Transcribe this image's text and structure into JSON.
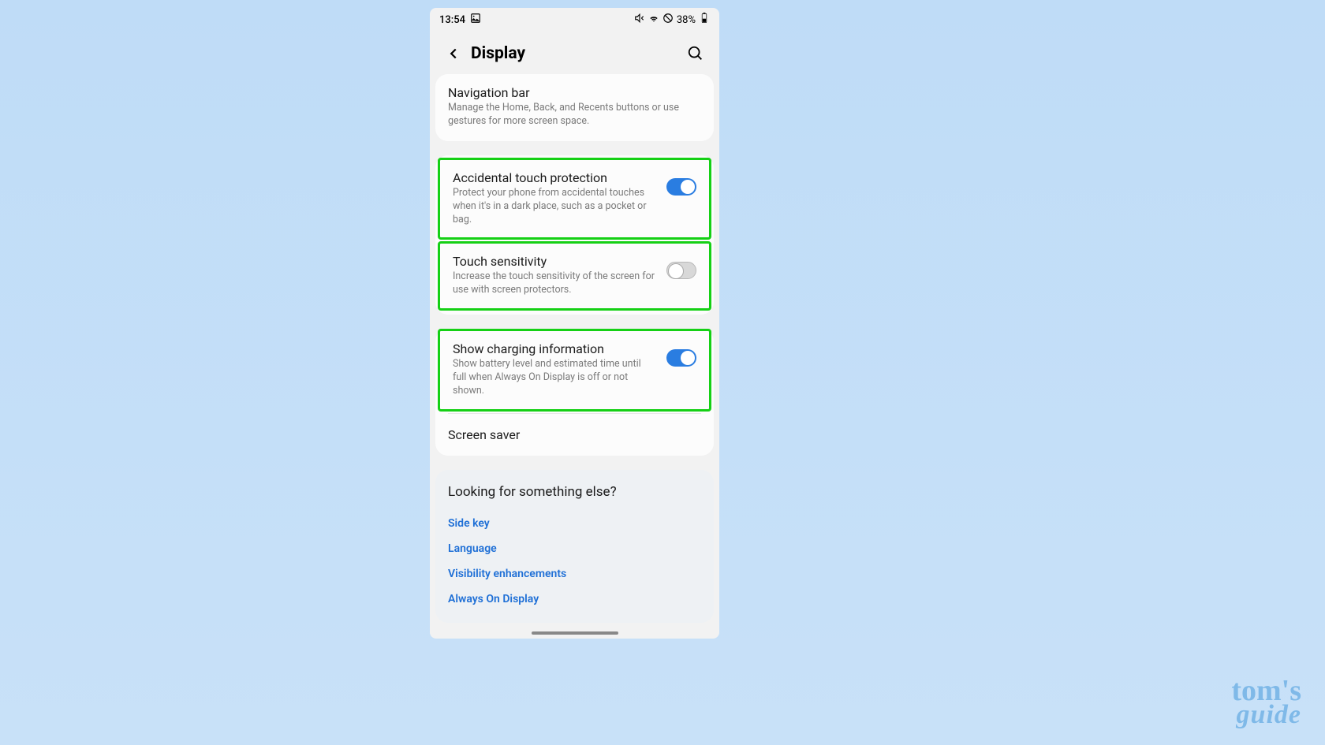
{
  "statusBar": {
    "time": "13:54",
    "battery": "38%"
  },
  "header": {
    "title": "Display"
  },
  "navCard": {
    "title": "Navigation bar",
    "desc": "Manage the Home, Back, and Recents buttons or use gestures for more screen space."
  },
  "settings": {
    "accidental": {
      "title": "Accidental touch protection",
      "desc": "Protect your phone from accidental touches when it's in a dark place, such as a pocket or bag."
    },
    "touchSensitivity": {
      "title": "Touch sensitivity",
      "desc": "Increase the touch sensitivity of the screen for use with screen protectors."
    },
    "charging": {
      "title": "Show charging information",
      "desc": "Show battery level and estimated time until full when Always On Display is off or not shown."
    },
    "screenSaver": "Screen saver"
  },
  "looking": {
    "title": "Looking for something else?",
    "links": [
      "Side key",
      "Language",
      "Visibility enhancements",
      "Always On Display"
    ]
  },
  "watermark": {
    "line1": "tom's",
    "line2": "guide"
  }
}
